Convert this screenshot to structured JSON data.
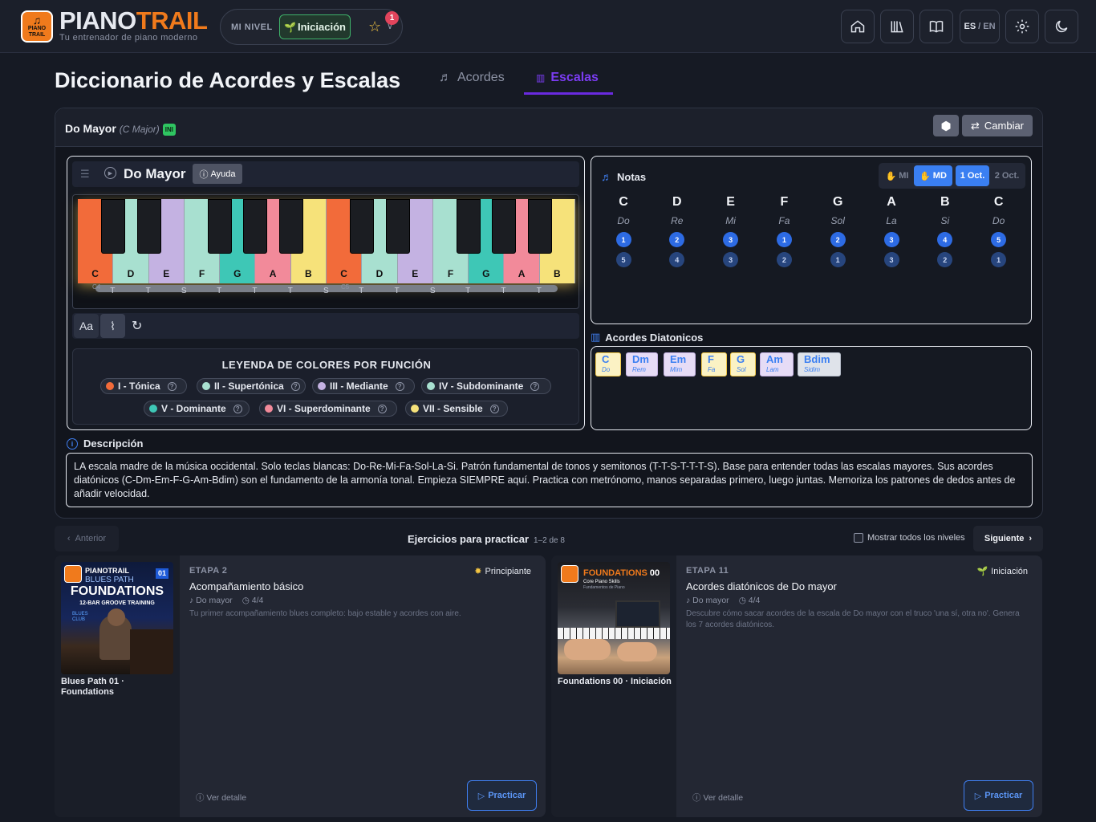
{
  "app": {
    "brand_a": "PIANO",
    "brand_b": "TRAIL",
    "tagline": "Tu entrenador de piano moderno",
    "logo_text": "PIANO TRAIL"
  },
  "level": {
    "label": "MI NIVEL",
    "current": "Iniciación",
    "badge": "1"
  },
  "topbar": {
    "lang_es": "ES",
    "lang_sep": "/",
    "lang_en": "EN"
  },
  "page": {
    "title": "Diccionario de Acordes y Escalas"
  },
  "tabs": [
    {
      "label": "Acordes",
      "icon": "music-note-icon"
    },
    {
      "label": "Escalas",
      "icon": "bar-chart-icon"
    }
  ],
  "panel": {
    "title": "Do Mayor",
    "subtitle": "(C Major)",
    "tag": "INI",
    "swap_label": "Cambiar"
  },
  "piano": {
    "title": "Do Mayor",
    "help_label": "Ayuda",
    "aa_label": "Aa",
    "white_keys": [
      {
        "n": "C",
        "c": "#f26b3a"
      },
      {
        "n": "D",
        "c": "#a8e0d0"
      },
      {
        "n": "E",
        "c": "#c4b2e2"
      },
      {
        "n": "F",
        "c": "#a8e0d0"
      },
      {
        "n": "G",
        "c": "#3ec7b6"
      },
      {
        "n": "A",
        "c": "#f28a9a"
      },
      {
        "n": "B",
        "c": "#f6e27a"
      },
      {
        "n": "C",
        "c": "#f26b3a"
      },
      {
        "n": "D",
        "c": "#a8e0d0"
      },
      {
        "n": "E",
        "c": "#c4b2e2"
      },
      {
        "n": "F",
        "c": "#a8e0d0"
      },
      {
        "n": "G",
        "c": "#3ec7b6"
      },
      {
        "n": "A",
        "c": "#f28a9a"
      },
      {
        "n": "B",
        "c": "#f6e27a"
      }
    ],
    "steps": [
      "T",
      "T",
      "S",
      "T",
      "T",
      "T",
      "S",
      "T",
      "T",
      "S",
      "T",
      "T",
      "T"
    ],
    "octave_labels": [
      "C4",
      "C5"
    ]
  },
  "legend": {
    "title": "LEYENDA DE COLORES POR FUNCIÓN",
    "items": [
      {
        "label": "I - Tónica",
        "color": "#f26b3a"
      },
      {
        "label": "II - Supertónica",
        "color": "#a8e0d0"
      },
      {
        "label": "III - Mediante",
        "color": "#c4b2e2"
      },
      {
        "label": "IV - Subdominante",
        "color": "#a8e0d0"
      },
      {
        "label": "V - Dominante",
        "color": "#3ec7b6"
      },
      {
        "label": "VI - Superdominante",
        "color": "#f28a9a"
      },
      {
        "label": "VII - Sensible",
        "color": "#f6e27a"
      }
    ]
  },
  "notes": {
    "title": "Notas",
    "hand_left": "MI",
    "hand_right": "MD",
    "oct1": "1 Oct.",
    "oct2": "2 Oct.",
    "items": [
      {
        "n": "C",
        "s": "Do",
        "r": "1",
        "l": "5"
      },
      {
        "n": "D",
        "s": "Re",
        "r": "2",
        "l": "4"
      },
      {
        "n": "E",
        "s": "Mi",
        "r": "3",
        "l": "3"
      },
      {
        "n": "F",
        "s": "Fa",
        "r": "1",
        "l": "2"
      },
      {
        "n": "G",
        "s": "Sol",
        "r": "2",
        "l": "1"
      },
      {
        "n": "A",
        "s": "La",
        "r": "3",
        "l": "3"
      },
      {
        "n": "B",
        "s": "Si",
        "r": "4",
        "l": "2"
      },
      {
        "n": "C",
        "s": "Do",
        "r": "5",
        "l": "1"
      }
    ]
  },
  "diatonic": {
    "title": "Acordes Diatonicos",
    "items": [
      {
        "n": "C",
        "s": "Do",
        "bg": "#fbf2c4",
        "fg": "#3a7ff2",
        "bd": "#f2c94c"
      },
      {
        "n": "Dm",
        "s": "Rem",
        "bg": "#e6dcf6",
        "fg": "#3a7ff2",
        "bd": "#c4b2e2"
      },
      {
        "n": "Em",
        "s": "Mim",
        "bg": "#e6dcf6",
        "fg": "#3a7ff2",
        "bd": "#c4b2e2"
      },
      {
        "n": "F",
        "s": "Fa",
        "bg": "#fbf2c4",
        "fg": "#3a7ff2",
        "bd": "#f2c94c"
      },
      {
        "n": "G",
        "s": "Sol",
        "bg": "#fbf2c4",
        "fg": "#3a7ff2",
        "bd": "#f2c94c"
      },
      {
        "n": "Am",
        "s": "Lam",
        "bg": "#e6dcf6",
        "fg": "#3a7ff2",
        "bd": "#c4b2e2"
      },
      {
        "n": "Bdim",
        "s": "Sidim",
        "bg": "#dfe3ea",
        "fg": "#3a7ff2",
        "bd": "#b8bfcc"
      }
    ]
  },
  "description": {
    "title": "Descripción",
    "text": "LA escala madre de la música occidental. Solo teclas blancas: Do-Re-Mi-Fa-Sol-La-Si. Patrón fundamental de tonos y semitonos (T-T-S-T-T-T-S). Base para entender todas las escalas mayores. Sus acordes diatónicos (C-Dm-Em-F-G-Am-Bdim) son el fundamento de la armonía tonal. Empieza SIEMPRE aquí. Practica con metrónomo, manos separadas primero, luego juntas. Memoriza los patrones de dedos antes de añadir velocidad."
  },
  "pager": {
    "prev": "Anterior",
    "title": "Ejercicios para practicar",
    "count": "1–2 de 8",
    "show_all": "Mostrar todos los niveles",
    "next": "Siguiente"
  },
  "exercises": [
    {
      "thumb_brand": "PIANOTRAIL",
      "thumb_series": "BLUES PATH",
      "thumb_num": "01",
      "thumb_title": "FOUNDATIONS",
      "thumb_sub": "12-BAR GROOVE TRAINING",
      "thumb_sign": "BLUES CLUB",
      "caption": "Blues Path 01 · Foundations",
      "stage": "ETAPA 2",
      "level": "Principiante",
      "level_icon": "✸",
      "title": "Acompañamiento básico",
      "key": "Do mayor",
      "meter": "4/4",
      "desc": "Tu primer acompañamiento blues completo: bajo estable y acordes con aire.",
      "detail": "Ver detalle",
      "practice": "Practicar"
    },
    {
      "thumb_brand": "FOUNDATIONS",
      "thumb_num": "00",
      "thumb_series": "Core Piano Skills",
      "thumb_sub": "Fundamentos de Piano",
      "caption": "Foundations 00 · Iniciación",
      "stage": "ETAPA 11",
      "level": "Iniciación",
      "level_icon": "🌱",
      "title": "Acordes diatónicos de Do mayor",
      "key": "Do mayor",
      "meter": "4/4",
      "desc": "Descubre cómo sacar acordes de la escala de Do mayor con el truco 'una sí, otra no'. Genera los 7 acordes diatónicos.",
      "detail": "Ver detalle",
      "practice": "Practicar"
    }
  ]
}
